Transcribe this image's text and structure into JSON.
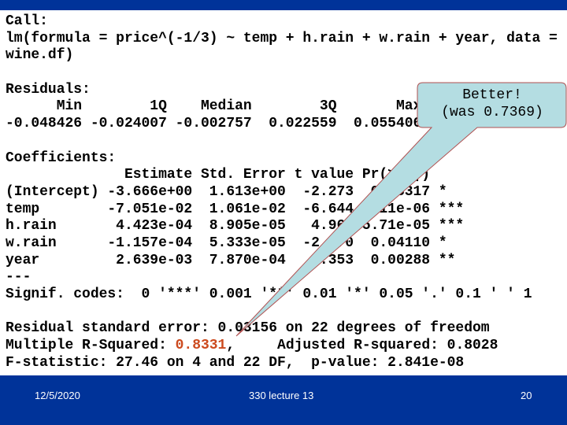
{
  "call": {
    "label": "Call:",
    "formula_line1": "lm(formula = price^(-1/3) ~ temp + h.rain + w.rain + year, data =",
    "formula_line2": "wine.df)"
  },
  "residuals": {
    "label": "Residuals:",
    "headers": [
      "Min",
      "1Q",
      "Median",
      "3Q",
      "Max"
    ],
    "values": [
      "-0.048426",
      "-0.024007",
      "-0.002757",
      "0.022559",
      "0.055406"
    ]
  },
  "coefficients": {
    "label": "Coefficients:",
    "headers": [
      "Estimate",
      "Std. Error",
      "t value",
      "Pr(>|t|)"
    ],
    "rows": [
      {
        "term": "(Intercept)",
        "estimate": "-3.666e+00",
        "std_error": "1.613e+00",
        "t_value": "-2.273",
        "p_value": "0.03317",
        "signif": "*"
      },
      {
        "term": "temp",
        "estimate": "-7.051e-02",
        "std_error": "1.061e-02",
        "t_value": "-6.644",
        "p_value": "1.11e-06",
        "signif": "***"
      },
      {
        "term": "h.rain",
        "estimate": "4.423e-04",
        "std_error": "8.905e-05",
        "t_value": "4.967",
        "p_value": "5.71e-05",
        "signif": "***"
      },
      {
        "term": "w.rain",
        "estimate": "-1.157e-04",
        "std_error": "5.333e-05",
        "t_value": "-2.170",
        "p_value": "0.04110",
        "signif": "*"
      },
      {
        "term": "year",
        "estimate": "2.639e-03",
        "std_error": "7.870e-04",
        "t_value": "3.353",
        "p_value": "0.00288",
        "signif": "**"
      }
    ],
    "separator": "---",
    "signif_codes": "Signif. codes:  0 '***' 0.001 '**' 0.01 '*' 0.05 '.' 0.1 ' ' 1"
  },
  "summary": {
    "rse_line": "Residual standard error: 0.03156 on 22 degrees of freedom",
    "r2_prefix": "Multiple R-Squared: ",
    "r2_value": "0.8331",
    "r2_suffix": ",     Adjusted R-squared: 0.8028",
    "f_line": "F-statistic: 27.46 on 4 and 22 DF,  p-value: 2.841e-08"
  },
  "callout": {
    "line1": "Better!",
    "line2": "(was 0.7369)",
    "fill_color": "#b4dde2",
    "border_color": "#b05050"
  },
  "colors": {
    "bar": "#003399",
    "highlight": "#cc4a1e"
  },
  "footer": {
    "date": "12/5/2020",
    "title": "330 lecture 13",
    "page": "20"
  }
}
